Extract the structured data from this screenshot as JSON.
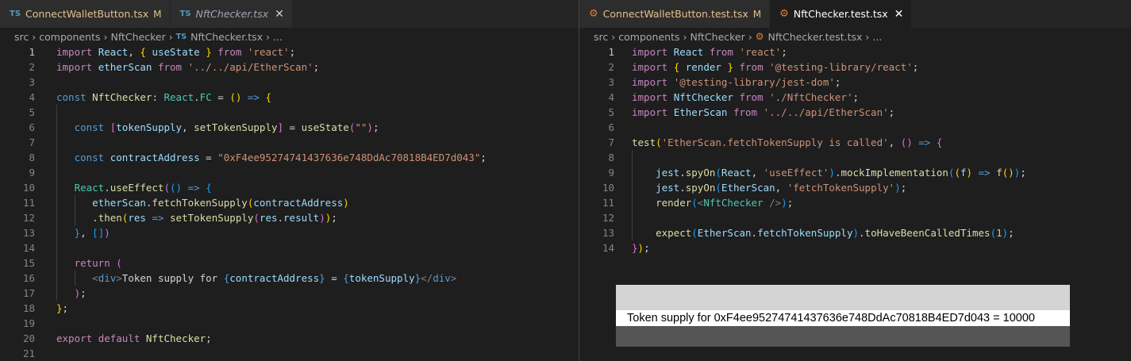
{
  "left_editor": {
    "tabs": [
      {
        "badge": "TS",
        "label": "ConnectWalletButton.tsx",
        "status": "M"
      },
      {
        "badge": "TS",
        "label": "NftChecker.tsx",
        "close": "✕"
      }
    ],
    "breadcrumb": {
      "seg1": "src",
      "seg2": "components",
      "seg3": "NftChecker",
      "badge": "TS",
      "seg4": "NftChecker.tsx",
      "seg5": "..."
    },
    "line_numbers": [
      "1",
      "2",
      "3",
      "4",
      "5",
      "6",
      "7",
      "8",
      "9",
      "10",
      "11",
      "12",
      "13",
      "14",
      "15",
      "16",
      "17",
      "18",
      "19",
      "20",
      "21"
    ]
  },
  "right_editor": {
    "tabs": [
      {
        "label": "ConnectWalletButton.test.tsx",
        "status": "M"
      },
      {
        "label": "NftChecker.test.tsx",
        "close": "✕"
      }
    ],
    "breadcrumb": {
      "seg1": "src",
      "seg2": "components",
      "seg3": "NftChecker",
      "seg4": "NftChecker.test.tsx",
      "seg5": "..."
    },
    "line_numbers": [
      "1",
      "2",
      "3",
      "4",
      "5",
      "6",
      "7",
      "8",
      "9",
      "10",
      "11",
      "12",
      "13",
      "14"
    ]
  },
  "preview": {
    "text": "Token supply for 0xF4ee95274741437636e748DdAc70818B4ED7d043 = 10000"
  },
  "colors": {
    "editor_bg": "#1e1e1e",
    "keyword": "#569cd6",
    "control": "#c586c0",
    "string": "#ce9178",
    "variable": "#9cdcfe",
    "function": "#dcdcaa",
    "type": "#4ec9b0"
  }
}
